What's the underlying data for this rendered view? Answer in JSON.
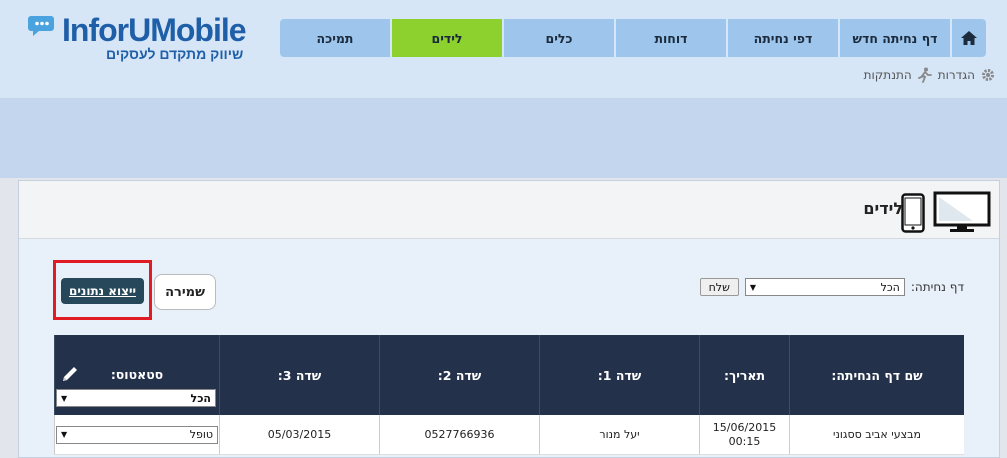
{
  "logo": {
    "brand": "InforU",
    "brand_suffix": "Mobile",
    "tagline": "שיווק מתקדם לעסקים"
  },
  "nav": {
    "tabs": [
      {
        "label": "דף נחיתה חדש",
        "active": false
      },
      {
        "label": "דפי נחיתה",
        "active": false
      },
      {
        "label": "דוחות",
        "active": false
      },
      {
        "label": "כלים",
        "active": false
      },
      {
        "label": "לידים",
        "active": true
      },
      {
        "label": "תמיכה",
        "active": false
      }
    ]
  },
  "sub_links": {
    "settings": "הגדרות",
    "logout": "התנתקות"
  },
  "panel": {
    "title": "לידים"
  },
  "filter": {
    "label": "דף נחיתה:",
    "selected": "הכל",
    "send": "שלח"
  },
  "actions": {
    "save": "שמירה",
    "export": "ייצוא נתונים"
  },
  "table": {
    "columns": [
      "שם דף הנחיתה:",
      "תאריך:",
      "שדה 1:",
      "שדה 2:",
      "שדה 3:",
      "סטאטוס:"
    ],
    "status_filter": "הכל",
    "rows": [
      {
        "page": "מבצעי אביב ססגוני",
        "date": "15/06/2015",
        "time": "00:15",
        "field1": "יעל מנור",
        "field2": "0527766936",
        "field3": "05/03/2015",
        "status": "טופל"
      }
    ]
  },
  "colors": {
    "nav_active": "#8cd12e",
    "nav_tab": "#9ec6ec",
    "table_head": "#23314a",
    "highlight": "#e11b24"
  }
}
